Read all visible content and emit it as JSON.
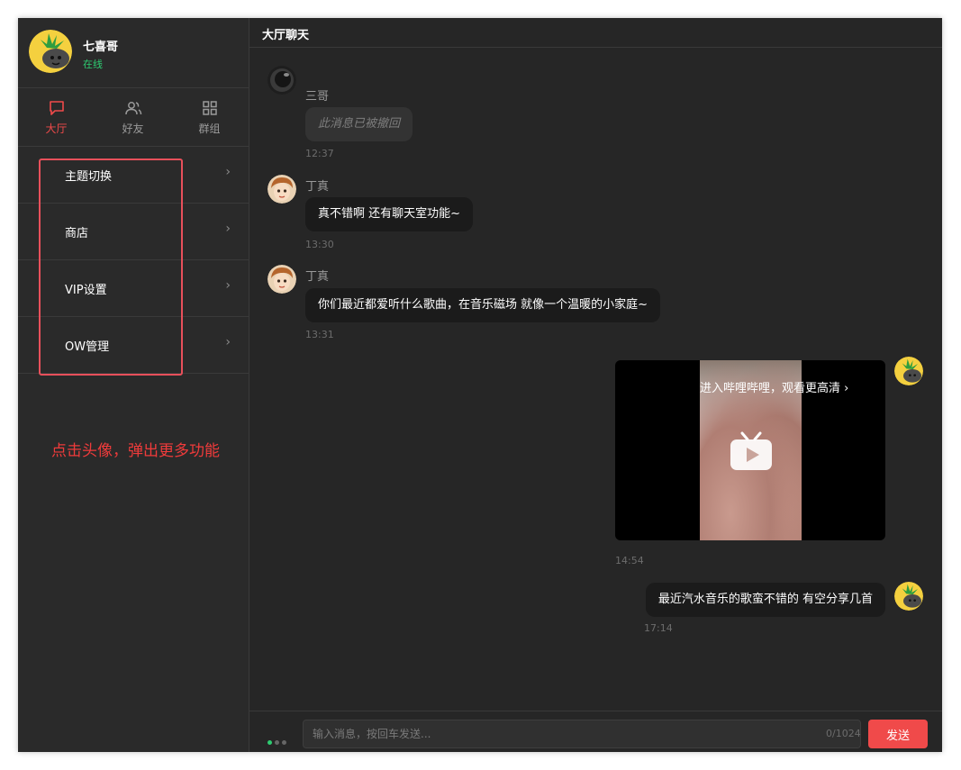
{
  "user": {
    "name": "七喜哥",
    "status": "在线",
    "avatar_icon": "pineapple-avatar-icon"
  },
  "nav": {
    "tabs": [
      {
        "label": "大厅",
        "icon": "chat-bubble-icon",
        "active": true
      },
      {
        "label": "好友",
        "icon": "users-icon",
        "active": false
      },
      {
        "label": "群组",
        "icon": "grid-icon",
        "active": false
      }
    ]
  },
  "menu": {
    "items": [
      {
        "label": "主题切换"
      },
      {
        "label": "商店"
      },
      {
        "label": "VIP设置"
      },
      {
        "label": "OW管理"
      }
    ],
    "chevron": "›"
  },
  "annotation": "点击头像，弹出更多功能",
  "chat": {
    "title": "大厅聊天",
    "messages": [
      {
        "sender": "三哥",
        "text": "此消息已被撤回",
        "time": "12:37",
        "recalled": true
      },
      {
        "sender": "丁真",
        "text": "真不错啊 还有聊天室功能~",
        "time": "13:30"
      },
      {
        "sender": "丁真",
        "text": "你们最近都爱听什么歌曲，在音乐磁场 就像一个温暖的小家庭~",
        "time": "13:31"
      },
      {
        "video_cta": "进入哔哩哔哩，观看更高清 ›",
        "time": "14:54",
        "self": true
      },
      {
        "text": "最近汽水音乐的歌蛮不错的 有空分享几首",
        "time": "17:14",
        "self": true
      }
    ]
  },
  "composer": {
    "placeholder": "输入消息，按回车发送...",
    "counter": "0/1024",
    "send_label": "发送"
  },
  "colors": {
    "accent": "#f04a4a",
    "online": "#2ecc71",
    "annotation": "#ef3b3b",
    "highlight": "#e8505b"
  }
}
